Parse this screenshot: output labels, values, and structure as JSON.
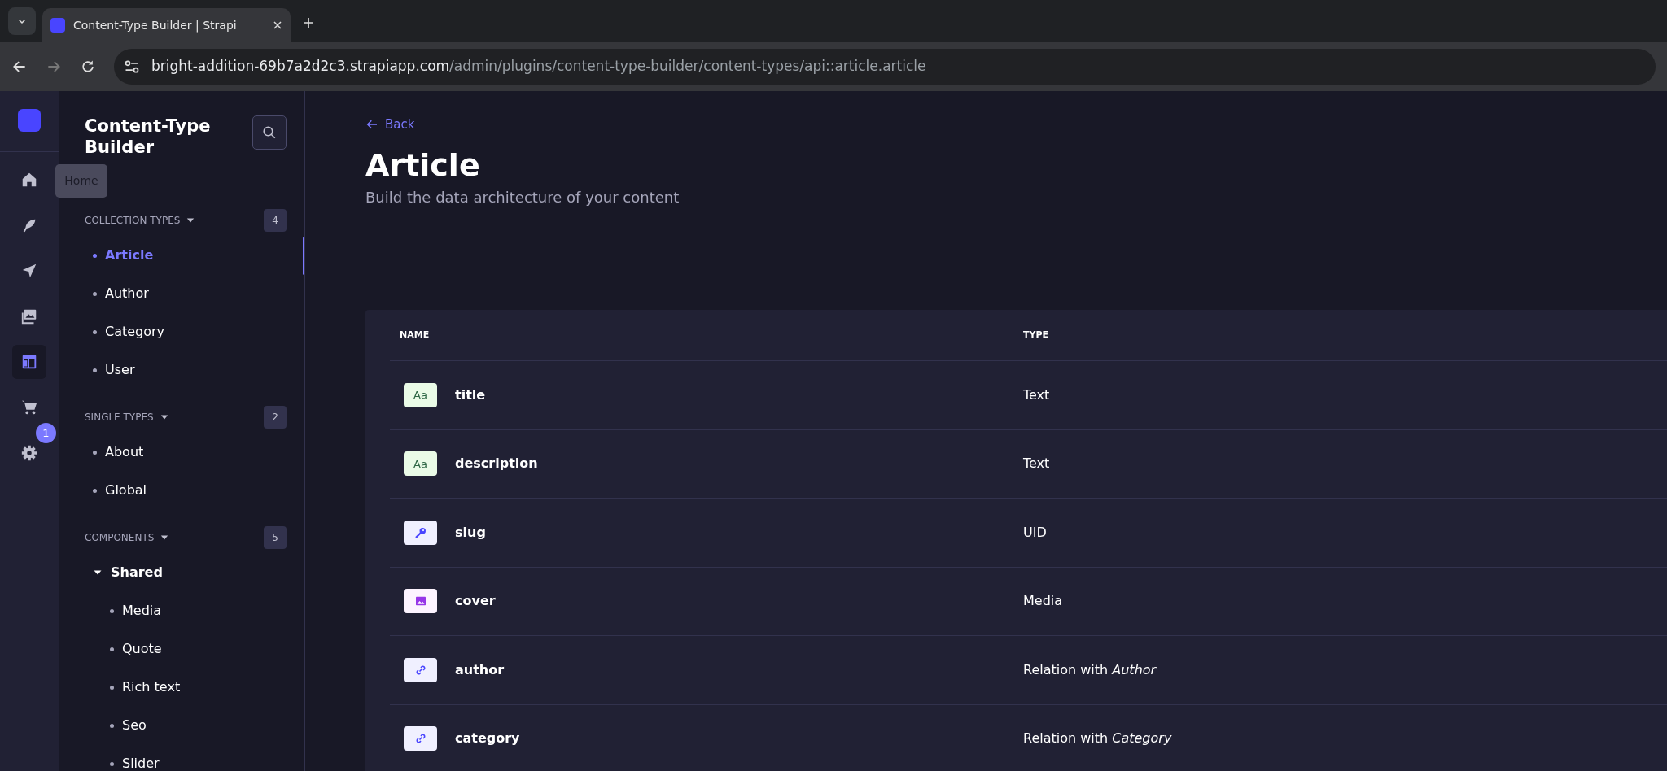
{
  "browser": {
    "tab_title": "Content-Type Builder | Strapi",
    "url_host": "bright-addition-69b7a2d2c3.strapiapp.com",
    "url_path": "/admin/plugins/content-type-builder/content-types/api::article.article"
  },
  "nav_rail": {
    "items": [
      {
        "kind": "home",
        "selected": false
      },
      {
        "kind": "feather",
        "selected": false
      },
      {
        "kind": "send",
        "selected": false
      },
      {
        "kind": "images",
        "selected": false
      },
      {
        "kind": "layout",
        "selected": true
      },
      {
        "kind": "cart",
        "selected": false
      },
      {
        "kind": "gear",
        "selected": false,
        "badge": "1"
      }
    ],
    "tooltip": "Home"
  },
  "sidebar": {
    "title": "Content-Type Builder",
    "sections": [
      {
        "label": "COLLECTION TYPES",
        "count": "4",
        "items": [
          {
            "label": "Article",
            "selected": true
          },
          {
            "label": "Author",
            "selected": false
          },
          {
            "label": "Category",
            "selected": false
          },
          {
            "label": "User",
            "selected": false
          }
        ]
      },
      {
        "label": "SINGLE TYPES",
        "count": "2",
        "items": [
          {
            "label": "About",
            "selected": false
          },
          {
            "label": "Global",
            "selected": false
          }
        ]
      },
      {
        "label": "COMPONENTS",
        "count": "5",
        "items": [
          {
            "label": "Shared",
            "selected": false,
            "expanded": true,
            "children": [
              {
                "label": "Media",
                "selected": false
              },
              {
                "label": "Quote",
                "selected": false
              },
              {
                "label": "Rich text",
                "selected": false
              },
              {
                "label": "Seo",
                "selected": false
              },
              {
                "label": "Slider",
                "selected": false
              }
            ]
          }
        ]
      }
    ]
  },
  "main": {
    "back": "Back",
    "title": "Article",
    "subtitle": "Build the data architecture of your content",
    "table": {
      "columns": [
        "NAME",
        "TYPE"
      ],
      "rows": [
        {
          "kind": "text",
          "icon_label": "Aa",
          "name": "title",
          "type": "Text"
        },
        {
          "kind": "text",
          "icon_label": "Aa",
          "name": "description",
          "type": "Text"
        },
        {
          "kind": "uid",
          "name": "slug",
          "type": "UID"
        },
        {
          "kind": "media",
          "name": "cover",
          "type": "Media"
        },
        {
          "kind": "relation",
          "name": "author",
          "type": "Relation with *Author*"
        },
        {
          "kind": "relation",
          "name": "category",
          "type": "Relation with *Category*"
        }
      ]
    }
  }
}
